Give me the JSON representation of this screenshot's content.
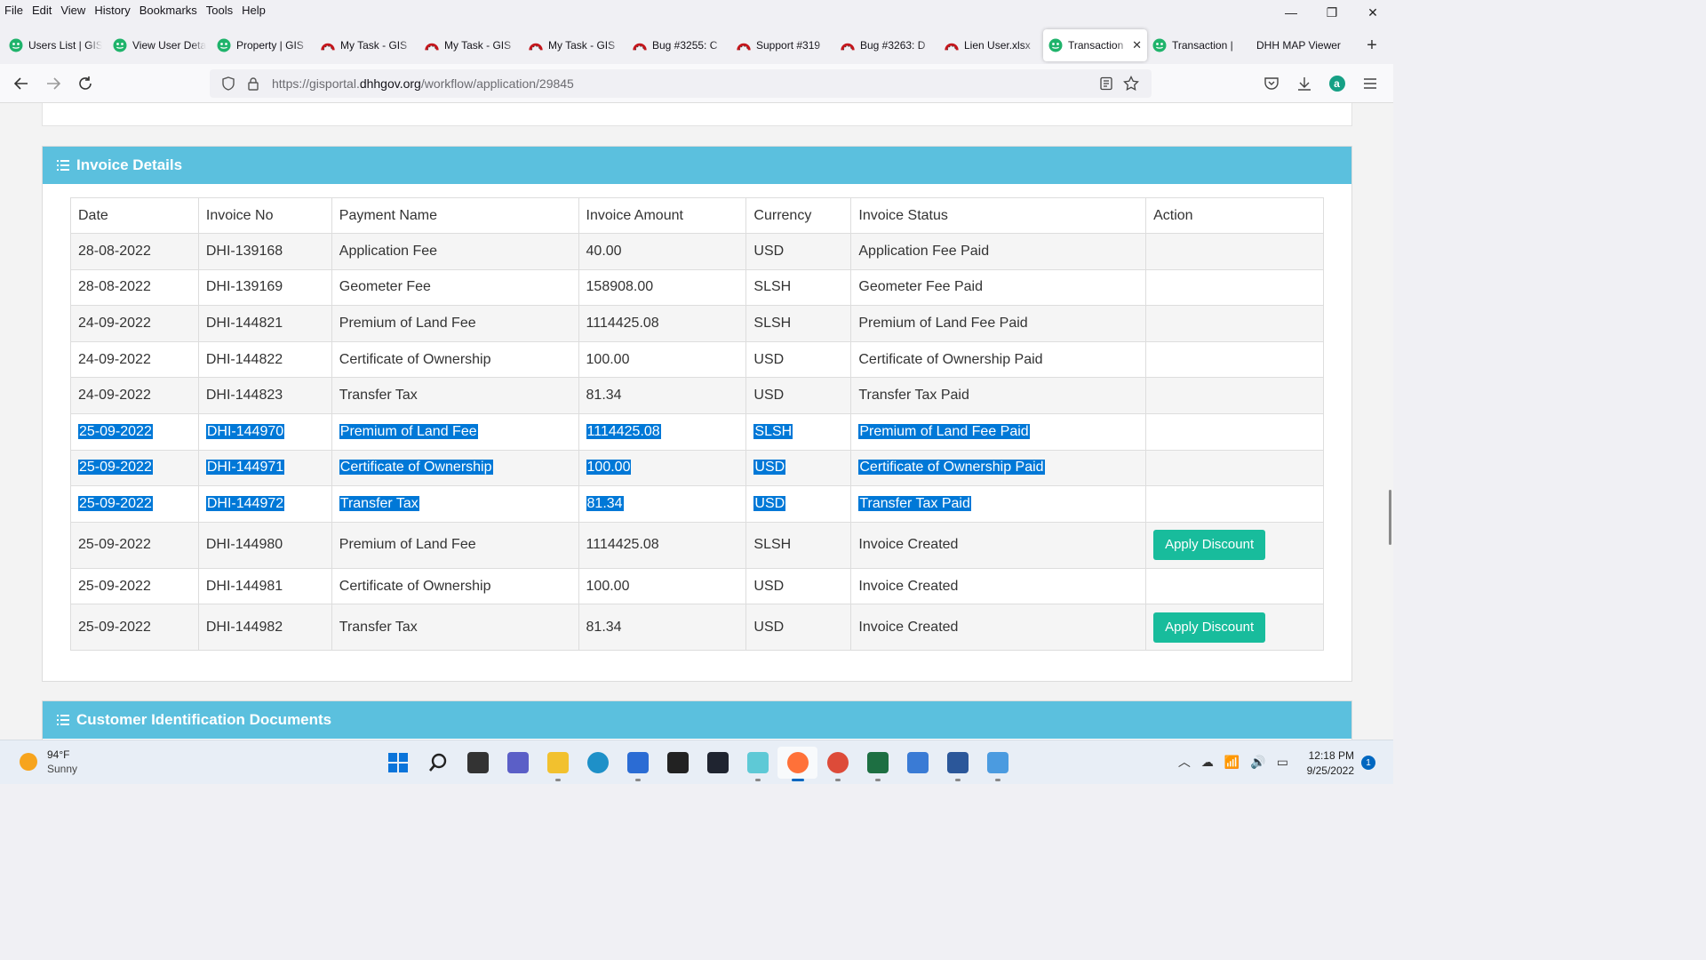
{
  "menu": [
    "File",
    "Edit",
    "View",
    "History",
    "Bookmarks",
    "Tools",
    "Help"
  ],
  "window_controls": {
    "minimize": "—",
    "restore": "❐",
    "close": "✕"
  },
  "tabs": [
    {
      "title": "Users List | GIS",
      "icon": "gis-favicon"
    },
    {
      "title": "View User Details",
      "icon": "gis-favicon"
    },
    {
      "title": "Property | GIS",
      "icon": "gis-favicon"
    },
    {
      "title": "My Task - GIS",
      "icon": "redmine-favicon"
    },
    {
      "title": "My Task - GIS",
      "icon": "redmine-favicon"
    },
    {
      "title": "My Task - GIS",
      "icon": "redmine-favicon"
    },
    {
      "title": "Bug #3255: C",
      "icon": "redmine-favicon"
    },
    {
      "title": "Support #319",
      "icon": "redmine-favicon"
    },
    {
      "title": "Bug #3263: D",
      "icon": "redmine-favicon"
    },
    {
      "title": "Lien User.xlsx",
      "icon": "redmine-favicon"
    },
    {
      "title": "Transaction",
      "icon": "gis-favicon",
      "active": true,
      "close": "✕"
    },
    {
      "title": "Transaction |",
      "icon": "gis-favicon"
    },
    {
      "title": "DHH MAP Viewer",
      "icon": "none"
    }
  ],
  "new_tab": "+",
  "url": {
    "prefix": "https://gisportal.",
    "domain": "dhhgov.org",
    "path": "/workflow/application/29845"
  },
  "colors": {
    "header_bg": "#5bc0de",
    "selection": "#0078d7",
    "discount_button": "#18bc9c",
    "gis_icon": "#1fb36b",
    "redmine_icon": "#c4161c"
  },
  "invoice_panel": {
    "title": "Invoice Details",
    "columns": [
      "Date",
      "Invoice No",
      "Payment Name",
      "Invoice Amount",
      "Currency",
      "Invoice Status",
      "Action"
    ],
    "rows": [
      {
        "date": "28-08-2022",
        "no": "DHI-139168",
        "name": "Application Fee",
        "amount": "40.00",
        "currency": "USD",
        "status": "Application Fee Paid",
        "action": "",
        "selected": false
      },
      {
        "date": "28-08-2022",
        "no": "DHI-139169",
        "name": "Geometer Fee",
        "amount": "158908.00",
        "currency": "SLSH",
        "status": "Geometer Fee Paid",
        "action": "",
        "selected": false
      },
      {
        "date": "24-09-2022",
        "no": "DHI-144821",
        "name": "Premium of Land Fee",
        "amount": "1114425.08",
        "currency": "SLSH",
        "status": "Premium of Land Fee Paid",
        "action": "",
        "selected": false
      },
      {
        "date": "24-09-2022",
        "no": "DHI-144822",
        "name": "Certificate of Ownership",
        "amount": "100.00",
        "currency": "USD",
        "status": "Certificate of Ownership Paid",
        "action": "",
        "selected": false
      },
      {
        "date": "24-09-2022",
        "no": "DHI-144823",
        "name": "Transfer Tax",
        "amount": "81.34",
        "currency": "USD",
        "status": "Transfer Tax Paid",
        "action": "",
        "selected": false
      },
      {
        "date": "25-09-2022",
        "no": "DHI-144970",
        "name": "Premium of Land Fee",
        "amount": "1114425.08",
        "currency": "SLSH",
        "status": "Premium of Land Fee Paid",
        "action": "",
        "selected": true
      },
      {
        "date": "25-09-2022",
        "no": "DHI-144971",
        "name": "Certificate of Ownership",
        "amount": "100.00",
        "currency": "USD",
        "status": "Certificate of Ownership Paid",
        "action": "",
        "selected": true
      },
      {
        "date": "25-09-2022",
        "no": "DHI-144972",
        "name": "Transfer Tax",
        "amount": "81.34",
        "currency": "USD",
        "status": "Transfer Tax Paid",
        "action": "",
        "selected": true
      },
      {
        "date": "25-09-2022",
        "no": "DHI-144980",
        "name": "Premium of Land Fee",
        "amount": "1114425.08",
        "currency": "SLSH",
        "status": "Invoice Created",
        "action": "Apply Discount",
        "selected": false
      },
      {
        "date": "25-09-2022",
        "no": "DHI-144981",
        "name": "Certificate of Ownership",
        "amount": "100.00",
        "currency": "USD",
        "status": "Invoice Created",
        "action": "",
        "selected": false
      },
      {
        "date": "25-09-2022",
        "no": "DHI-144982",
        "name": "Transfer Tax",
        "amount": "81.34",
        "currency": "USD",
        "status": "Invoice Created",
        "action": "Apply Discount",
        "selected": false
      }
    ]
  },
  "documents_panel": {
    "title": "Customer Identification Documents"
  },
  "taskbar": {
    "weather": {
      "temp": "94°F",
      "condition": "Sunny"
    },
    "apps": [
      {
        "name": "start",
        "color": "#0a74da"
      },
      {
        "name": "search",
        "color": "#222222"
      },
      {
        "name": "task-view",
        "color": "#333333"
      },
      {
        "name": "teams-chat",
        "color": "#5b5fc7"
      },
      {
        "name": "file-explorer",
        "color": "#f2c12e"
      },
      {
        "name": "edge",
        "color": "#1e90c8"
      },
      {
        "name": "store",
        "color": "#2b6cd4"
      },
      {
        "name": "amazon",
        "color": "#222222"
      },
      {
        "name": "dropbox",
        "color": "#1f2430"
      },
      {
        "name": "messenger",
        "color": "#5ec9d6"
      },
      {
        "name": "firefox",
        "color": "#ff7139",
        "active": true
      },
      {
        "name": "chrome",
        "color": "#dd4b39"
      },
      {
        "name": "excel",
        "color": "#1d6f42"
      },
      {
        "name": "photos",
        "color": "#3a7bd5"
      },
      {
        "name": "word",
        "color": "#2b579a"
      },
      {
        "name": "notepad",
        "color": "#4b9be0"
      }
    ],
    "time": "12:18 PM",
    "date": "9/25/2022",
    "notifications": "1"
  }
}
